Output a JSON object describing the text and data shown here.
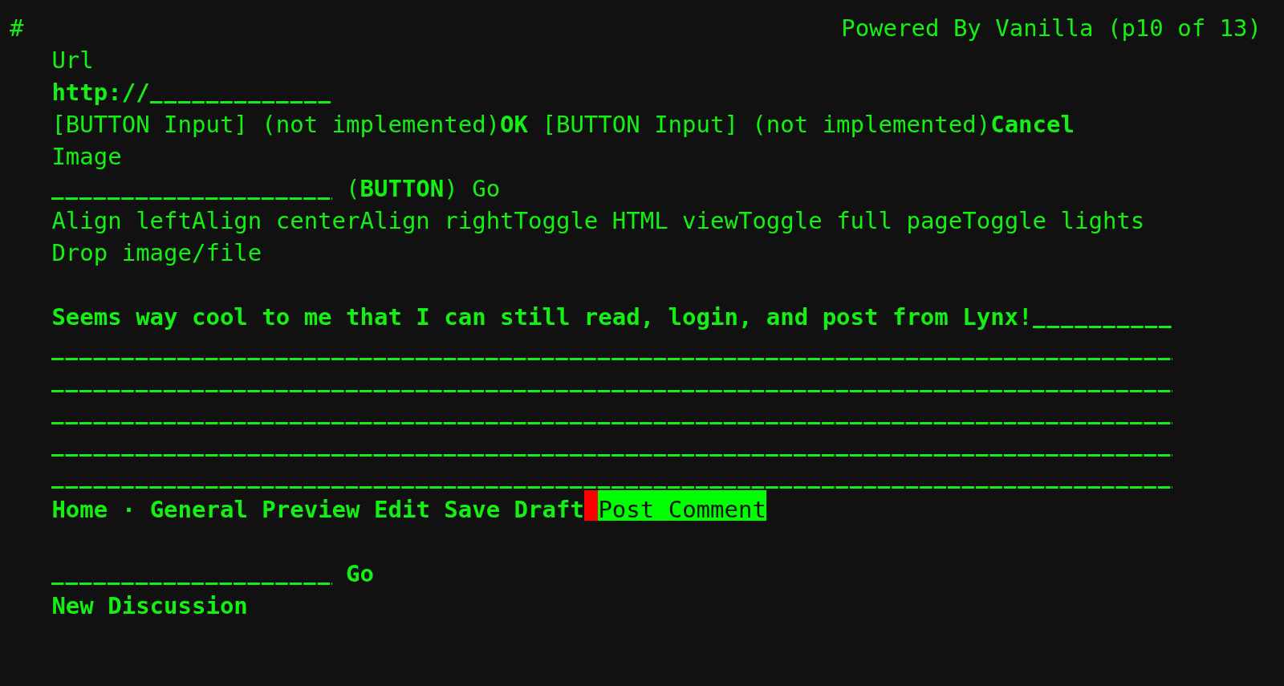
{
  "header": {
    "marker": "#",
    "title": "Powered By Vanilla (p10 of 13)"
  },
  "link_form": {
    "label": "Url",
    "url_field": {
      "value": "http://"
    },
    "buttons": [
      {
        "note": "[BUTTON Input] (not implemented)",
        "label": "OK"
      },
      {
        "note": "[BUTTON Input] (not implemented)",
        "label": "Cancel"
      }
    ]
  },
  "image_form": {
    "label": "Image",
    "button": "(**BUTTON**) Go"
  },
  "editor_toolbar": {
    "buttons": [
      "Align left",
      "Align center",
      "Align right",
      "Toggle HTML view",
      "Toggle full page",
      "Toggle lights"
    ]
  },
  "drop_zone": {
    "label": "Drop image/file"
  },
  "comment_box": {
    "value": "Seems way cool to me that I can still read, login, and post from Lynx!"
  },
  "footer_nav": {
    "breadcrumbs": [
      {
        "label": "Home",
        "selected": false
      },
      {
        "label": "General",
        "selected": false
      }
    ],
    "separator": "·",
    "actions": [
      {
        "label": "Preview",
        "selected": false
      },
      {
        "label": "Edit",
        "selected": false
      },
      {
        "label": "Save Draft",
        "selected": false
      },
      {
        "label": "Post Comment",
        "selected": true
      }
    ]
  },
  "search": {
    "button": "Go"
  },
  "new_discussion": {
    "label": "New Discussion"
  }
}
